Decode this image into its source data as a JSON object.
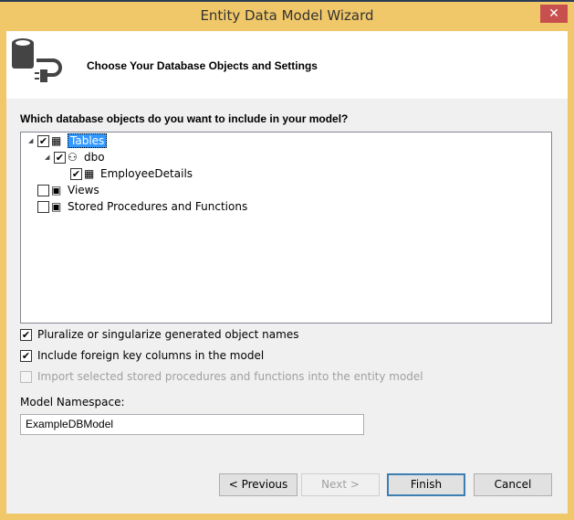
{
  "window": {
    "title": "Entity Data Model Wizard",
    "close": "✕"
  },
  "header": {
    "title": "Choose Your Database Objects and Settings"
  },
  "question": "Which database objects do you want to include in your model?",
  "tree": [
    {
      "label": "Tables",
      "checked": true,
      "selected": true
    },
    {
      "label": "dbo",
      "checked": true
    },
    {
      "label": "EmployeeDetails",
      "checked": true
    },
    {
      "label": "Views",
      "checked": false
    },
    {
      "label": "Stored Procedures and Functions",
      "checked": false
    }
  ],
  "options": [
    {
      "label": "Pluralize or singularize generated object names",
      "checked": true
    },
    {
      "label": "Include foreign key columns in the model",
      "checked": true
    },
    {
      "label": "Import selected stored procedures and functions into the entity model",
      "checked": false,
      "disabled": true
    }
  ],
  "namespace": {
    "label": "Model Namespace:",
    "value": "ExampleDBModel"
  },
  "buttons": {
    "previous": "< Previous",
    "next": "Next >",
    "finish": "Finish",
    "cancel": "Cancel"
  },
  "check": "✔"
}
